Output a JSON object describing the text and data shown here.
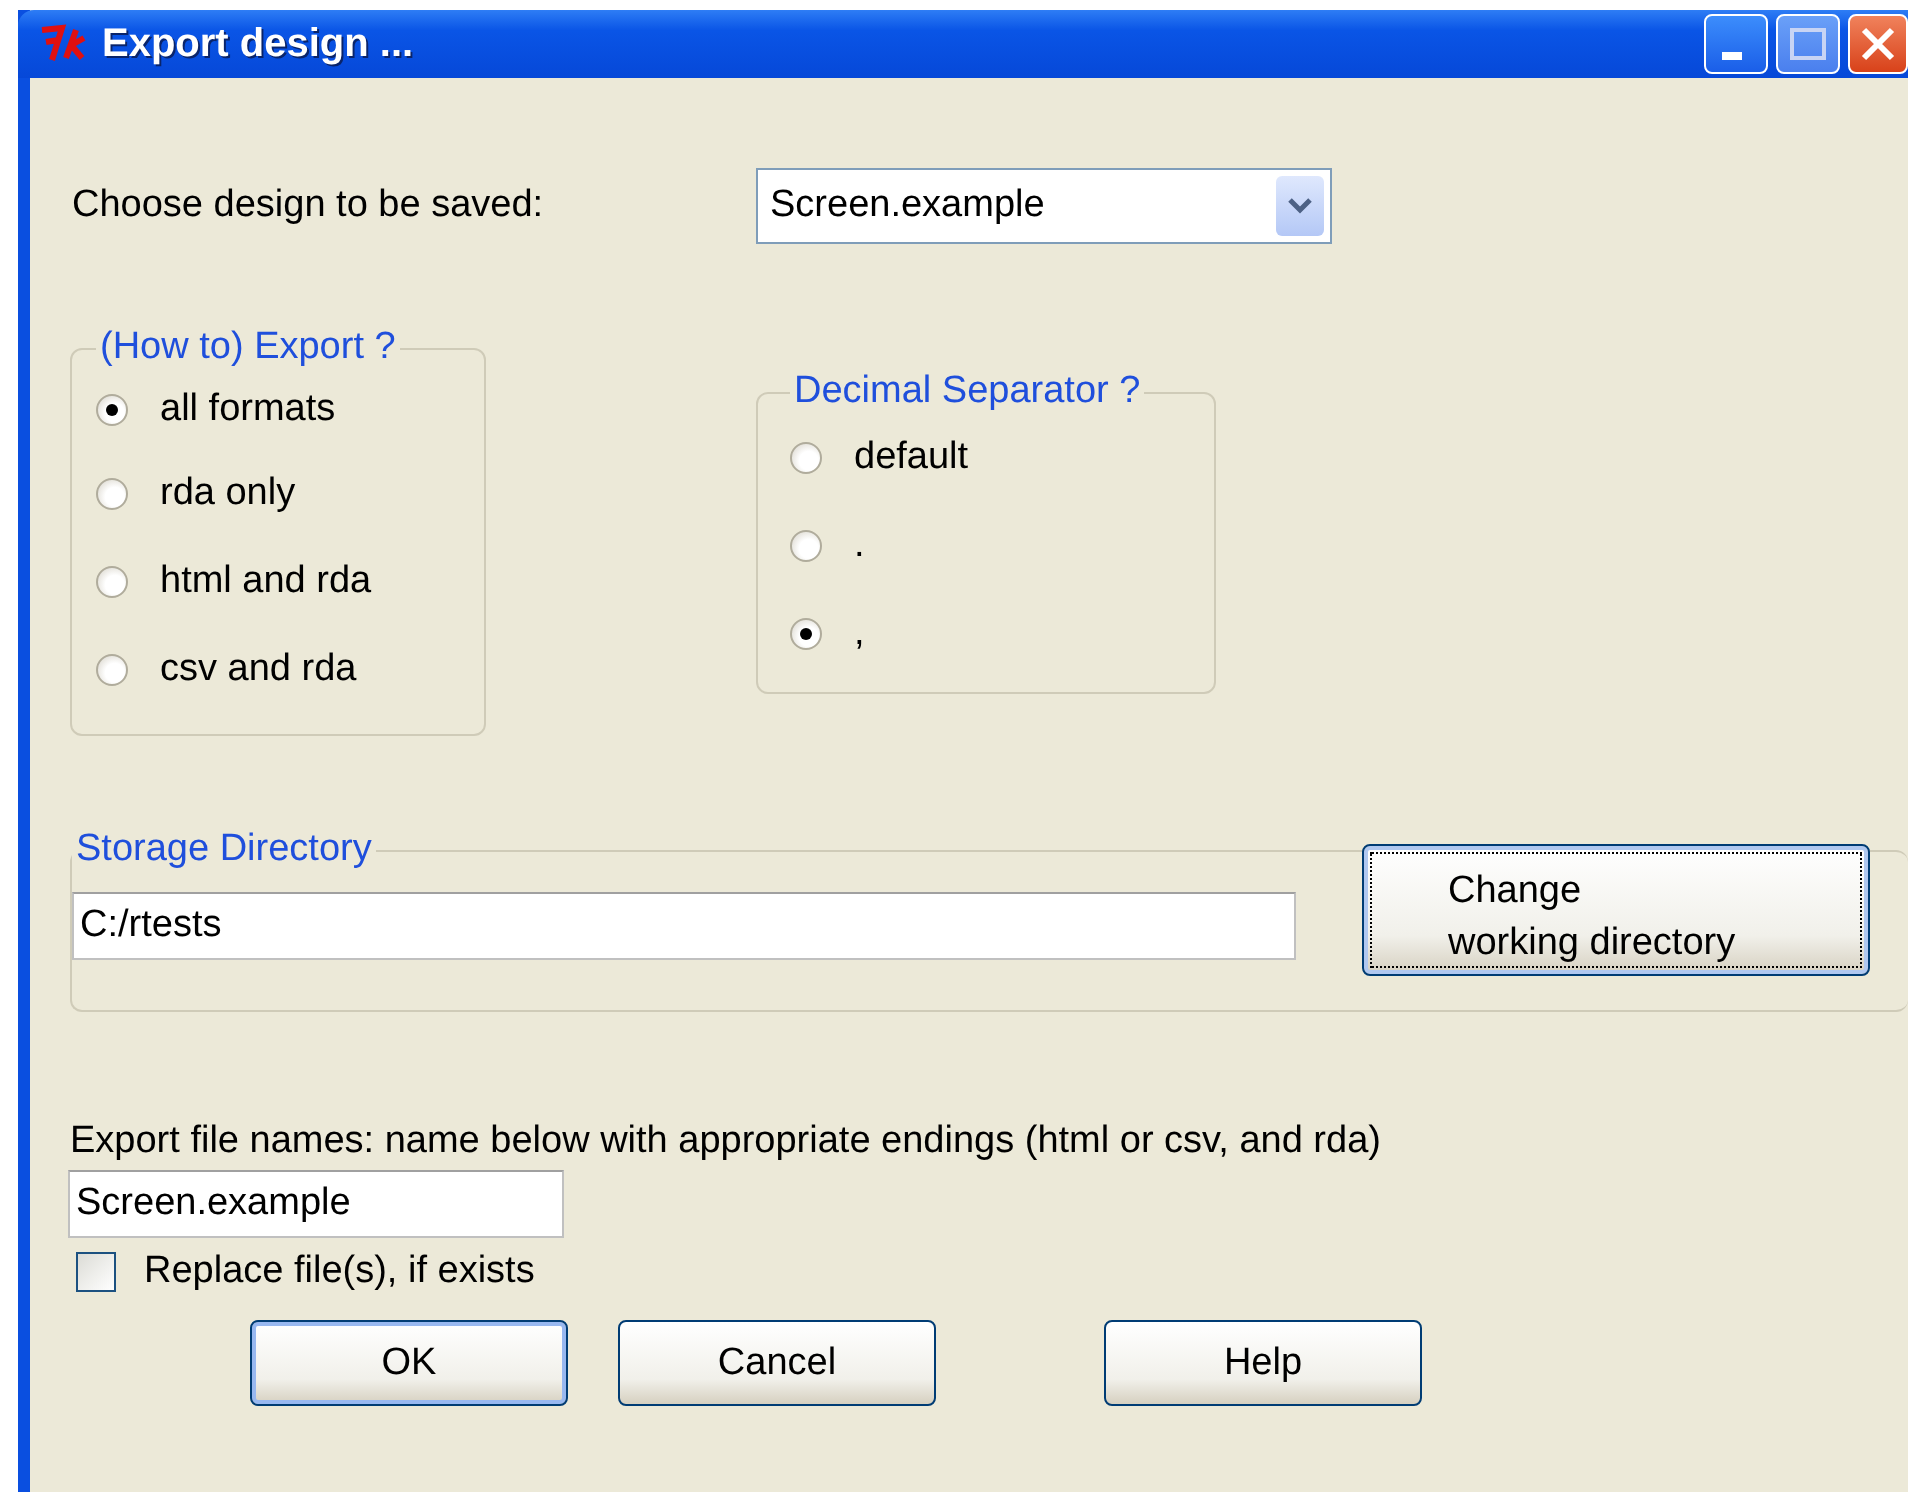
{
  "window": {
    "title": "Export design ..."
  },
  "design": {
    "label": "Choose design to be saved:",
    "value": "Screen.example"
  },
  "export_group": {
    "title": "(How to) Export ?",
    "options": [
      {
        "label": "all formats",
        "selected": true
      },
      {
        "label": "rda only",
        "selected": false
      },
      {
        "label": "html and rda",
        "selected": false
      },
      {
        "label": "csv and rda",
        "selected": false
      }
    ]
  },
  "decimal_group": {
    "title": "Decimal Separator ?",
    "options": [
      {
        "label": "default",
        "selected": false
      },
      {
        "label": ".",
        "selected": false
      },
      {
        "label": ",",
        "selected": true
      }
    ]
  },
  "storage": {
    "title": "Storage Directory",
    "value": "C:/rtests",
    "button_lines": [
      "Change",
      "working directory"
    ]
  },
  "file_names": {
    "label": "Export file names: name below with appropriate endings (html or csv, and rda)",
    "value": "Screen.example"
  },
  "replace": {
    "label": "Replace file(s), if exists",
    "checked": false
  },
  "buttons": [
    {
      "label": "OK",
      "focused": true
    },
    {
      "label": "Cancel",
      "focused": false
    },
    {
      "label": "Help",
      "focused": false
    }
  ]
}
